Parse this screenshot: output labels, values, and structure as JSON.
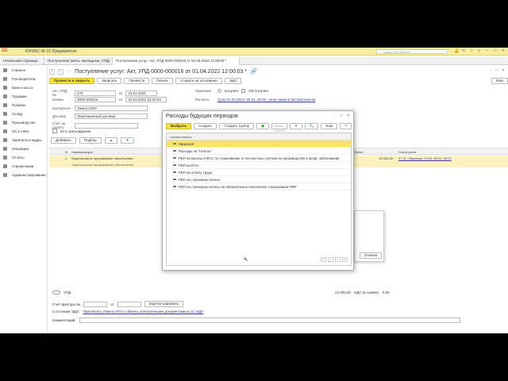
{
  "app": {
    "title": "ЮНИКС-М 1С:Предприятие",
    "search_placeholder": "Поиск Ctrl+Shift+F",
    "logo": "1С"
  },
  "tabs": [
    {
      "label": "Начальная страница"
    },
    {
      "label": "Поступления (акты, накладные, УПД)"
    },
    {
      "label": "Поступление услуг: Акт, УПД 0000-000016 от 01.04.2022 12:00:03 *"
    }
  ],
  "sidebar": [
    {
      "label": "Главное",
      "icon": "menu-icon"
    },
    {
      "label": "Руководителю",
      "icon": "chart-icon"
    },
    {
      "label": "Банк и касса",
      "icon": "bank-icon"
    },
    {
      "label": "Продажи",
      "icon": "cart-icon"
    },
    {
      "label": "Покупки",
      "icon": "basket-icon"
    },
    {
      "label": "Склад",
      "icon": "box-icon"
    },
    {
      "label": "Производство",
      "icon": "factory-icon"
    },
    {
      "label": "ОС и НМА",
      "icon": "building-icon"
    },
    {
      "label": "Зарплата и кадры",
      "icon": "people-icon"
    },
    {
      "label": "Операции",
      "icon": "ops-icon"
    },
    {
      "label": "Отчеты",
      "icon": "report-icon"
    },
    {
      "label": "Справочники",
      "icon": "book-icon"
    },
    {
      "label": "Администрирование",
      "icon": "gear-icon"
    }
  ],
  "doc": {
    "title": "Поступление услуг: Акт, УПД 0000-000016 от 01.04.2022 12:00:03 *",
    "toolbar": {
      "post_close": "Провести и закрыть",
      "save": "Записать",
      "post": "Провести",
      "print": "Печать",
      "create_based": "Создать на основании",
      "edo": "ЭДО",
      "more": "Еще"
    },
    "fields": {
      "act_label": "Акт, УПД №",
      "act_value": "478",
      "from1": "от",
      "date1": "01.04.2022",
      "num_label": "Номер",
      "num_value": "0000-000016",
      "from2": "от",
      "date2": "01.04.2022 12:00:03",
      "contractor_label": "Контрагент",
      "contractor_value": "Омега ООО",
      "contract_label": "Договор",
      "contract_value": "Лицензионный договор",
      "invoice_label": "Счет на оплату",
      "has_disc": "Есть расхождения",
      "original_label": "Оригинал",
      "original_opt1": "получен",
      "original_opt2": "СФ получен",
      "payments_label": "Расчеты",
      "payments_link": "Срок 01.04.2022, 60.01, 60.02, зачет аванса автоматически"
    },
    "grid_buttons": {
      "add": "Добавить",
      "select": "Подбор"
    },
    "grid_headers": {
      "n": "N",
      "nom": "Номенклатура",
      "sum": "Всего",
      "acct": "Счета учета"
    },
    "grid_rows": [
      {
        "n": "1",
        "nom": "Лицензионное программное обеспечение",
        "sum": "12 000,00",
        "acct": "97.21, Лицензия, 19.04, 60.01, 60.02"
      }
    ],
    "footer": {
      "upd_label": "УПД",
      "invoice_label": "Счет-фактура №",
      "from": "от",
      "register": "Зарегистрировать",
      "edo_label": "Состояние ЭДО:",
      "edo_link": "Пригласить Омега ООО к обмену электронными документами в 1С:ЭДО",
      "comment_label": "Комментарий:",
      "total": "12 000,00",
      "vat_label": "НДС (в сумме):",
      "vat": "0,00"
    }
  },
  "dialog": {
    "title": "Расходы будущих периодов",
    "toolbar": {
      "select": "Выбрать",
      "create": "Создать",
      "create_group": "Создать группу",
      "search_placeholder": "Поиск (Ctrl+F)",
      "more": "Еще"
    },
    "header": "Наименование",
    "items": [
      "Лицензия",
      "Расходы на \"Платон\"",
      "РБП на взносы в ФСС по страхованию от несчастных случаев на производстве и проф. заболеваний",
      "РБП на ЕСН",
      "РБП на оплату труда",
      "РБП на страховые взносы",
      "РБП на страховые взносы на обязательное пенсионное страхование ПФР"
    ],
    "selected_index": 0
  },
  "mini_dialog": {
    "cancel": "Отмена"
  },
  "colors": {
    "accent": "#fbe243",
    "topbar": "#fbed9e",
    "selected_row": "#fbe55f"
  }
}
